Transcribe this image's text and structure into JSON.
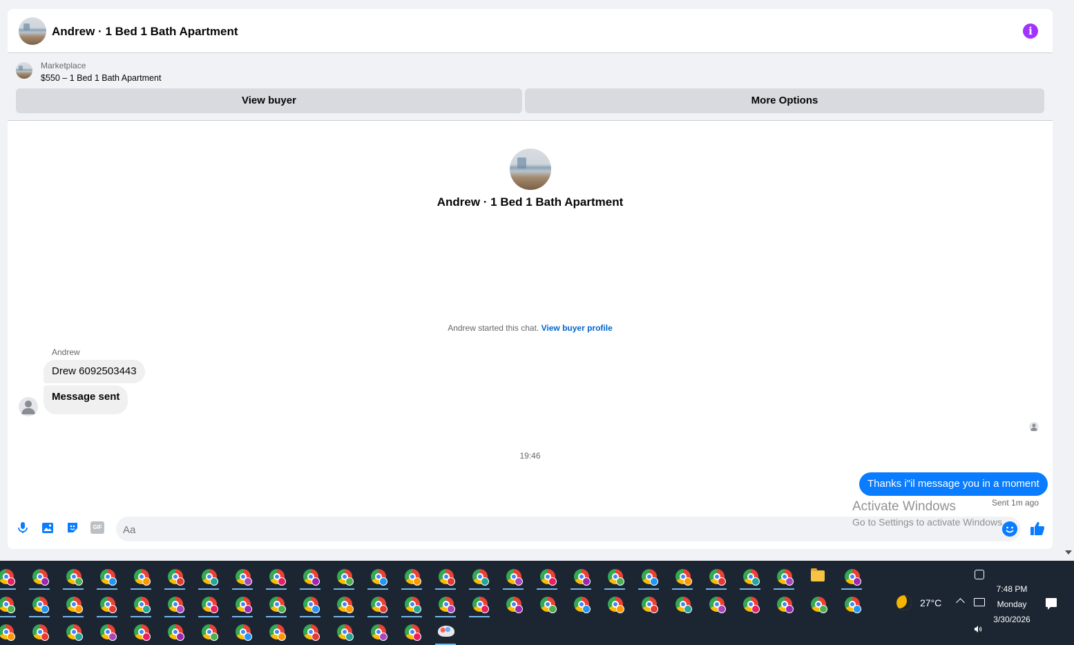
{
  "header": {
    "title": "Andrew · 1 Bed 1 Bath Apartment",
    "info_icon": "info-icon"
  },
  "listing": {
    "source": "Marketplace",
    "title": "$550 – 1 Bed 1 Bath Apartment",
    "view_buyer_label": "View buyer",
    "more_options_label": "More Options"
  },
  "profile": {
    "name": "Andrew · 1 Bed 1 Bath Apartment"
  },
  "chat": {
    "started_text": "Andrew started this chat.",
    "view_profile_link": "View buyer profile",
    "sender_name": "Andrew",
    "incoming": [
      "Drew 6092503443",
      "Message sent"
    ],
    "timestamp": "19:46",
    "outgoing": "Thanks i\"il message you in a moment",
    "sent_status": "Sent 1m ago"
  },
  "composer": {
    "placeholder": "Aa",
    "icons": [
      "microphone-icon",
      "photo-icon",
      "sticker-icon",
      "gif-icon"
    ],
    "gif_label": "GIF"
  },
  "watermark": {
    "line1": "Activate Windows",
    "line2": "Go to Settings to activate Windows."
  },
  "taskbar": {
    "temperature": "27°C",
    "time": "7:48 PM",
    "day": "Monday",
    "date": "3/30/2026",
    "badge_colors": [
      "#e91e63",
      "#9c27b0",
      "#4caf50",
      "#2196f3",
      "#ff9800",
      "#e53935",
      "#26a69a",
      "#ab47bc"
    ]
  },
  "colors": {
    "accent": "#0a7cff",
    "info": "#a033ff",
    "link": "#0064d1"
  }
}
